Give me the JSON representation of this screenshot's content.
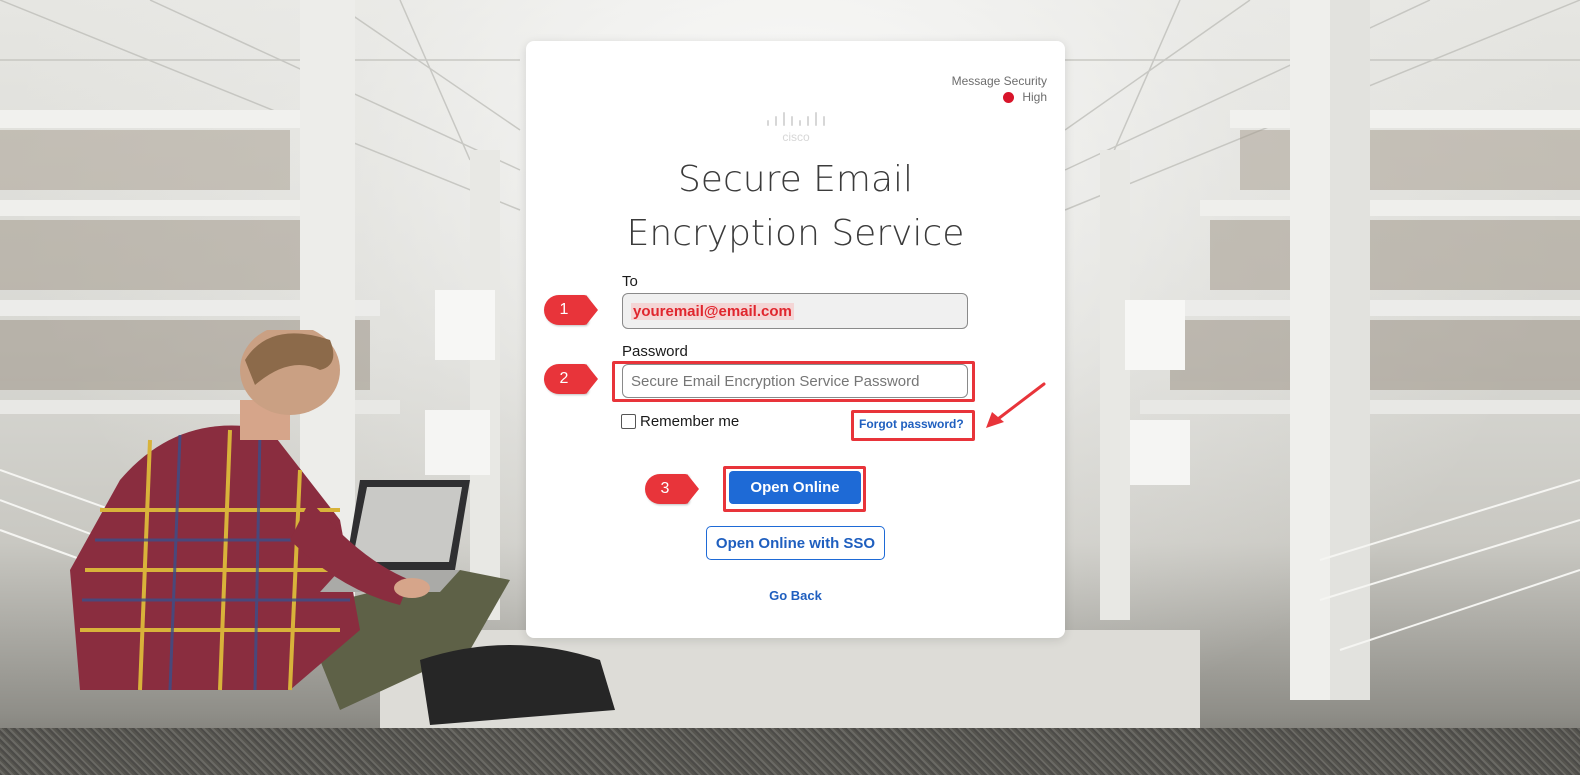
{
  "card": {
    "security_label": "Message Security",
    "security_level": "High",
    "security_color": "#d8142a",
    "logo_text": "cisco",
    "title_line1": "Secure Email",
    "title_line2": "Encryption Service"
  },
  "form": {
    "to_label": "To",
    "to_value": "youremail@email.com",
    "password_label": "Password",
    "password_placeholder": "Secure Email Encryption Service Password",
    "remember_label": "Remember me",
    "forgot_label": "Forgot password?",
    "open_online_label": "Open Online",
    "open_sso_label": "Open Online with SSO",
    "go_back_label": "Go Back"
  },
  "annotations": {
    "steps": [
      "1",
      "2",
      "3"
    ],
    "color": "#e8343a"
  },
  "colors": {
    "primary": "#1e6ad6",
    "link": "#1f5fbf"
  }
}
